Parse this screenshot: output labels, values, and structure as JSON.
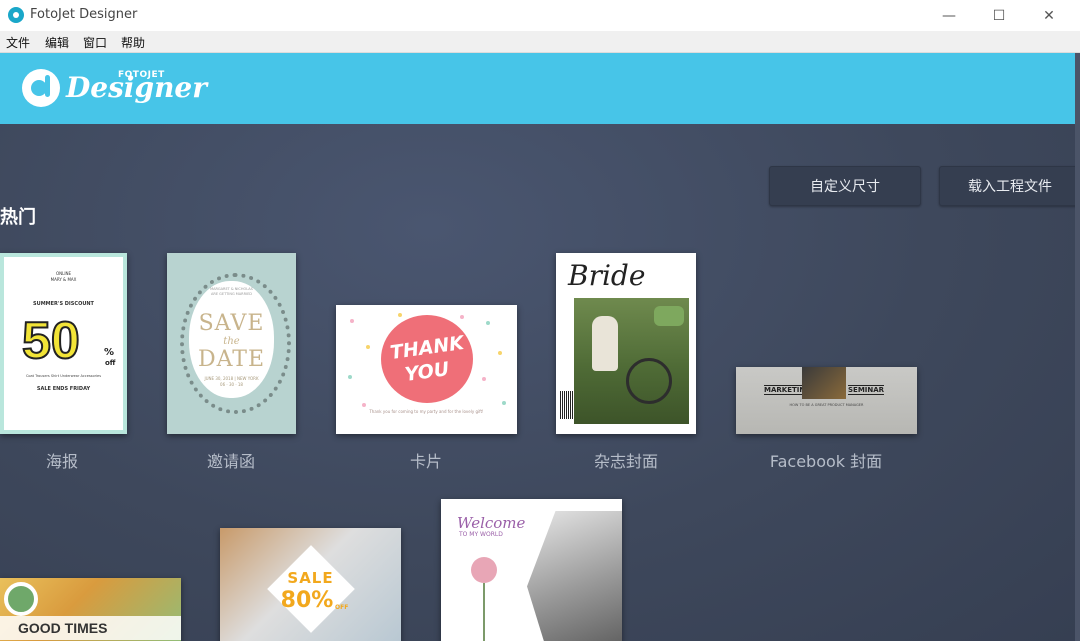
{
  "window": {
    "title": "FotoJet Designer",
    "controls": {
      "minimize": "—",
      "maximize": "☐",
      "close": "✕"
    }
  },
  "menu": [
    "文件",
    "编辑",
    "窗口",
    "帮助"
  ],
  "header": {
    "logo_small": "FOTOJET",
    "logo_word": "Designer",
    "bg_color": "#47c5e8"
  },
  "actions": {
    "custom_size": "自定义尺寸",
    "load_project": "载入工程文件"
  },
  "section": {
    "title": "热门"
  },
  "templates": [
    {
      "label": "海报",
      "thumb": {
        "line1": "ONLINE",
        "line2": "MARY & MAX",
        "headline": "SUMMER'S DISCOUNT",
        "big": "50",
        "pct": "%",
        "off": "off",
        "categories": "Coat  Trousers  Shirt  Underwear  Accessories",
        "footer": "SALE ENDS FRIDAY"
      }
    },
    {
      "label": "邀请函",
      "thumb": {
        "names": "MARGARET & NICHOLAS",
        "names_sub": "ARE GETTING MARRIED",
        "save": "SAVE",
        "the": "the",
        "date": "DATE",
        "when": "JUNE 30, 2018 | NEW YORK",
        "digits": "06 · 30 · 18"
      }
    },
    {
      "label": "卡片",
      "thumb": {
        "thank": "THANK",
        "you": "YOU",
        "message": "Thank you for coming to my party and for the lovely gift!"
      }
    },
    {
      "label": "杂志封面",
      "thumb": {
        "title": "Bride"
      }
    },
    {
      "label": "Facebook 封面",
      "thumb": {
        "left": "MARKETING",
        "right": "SEMINAR",
        "sub": "HOW TO BE A GREAT PRODUCT MANAGER"
      }
    },
    {
      "label": "",
      "thumb": {
        "text": "GOOD TIMES"
      }
    },
    {
      "label": "",
      "thumb": {
        "sale": "SALE",
        "pct": "80%",
        "off": "OFF"
      }
    },
    {
      "label": "",
      "thumb": {
        "welcome": "Welcome",
        "sub": "TO MY WORLD"
      }
    }
  ]
}
